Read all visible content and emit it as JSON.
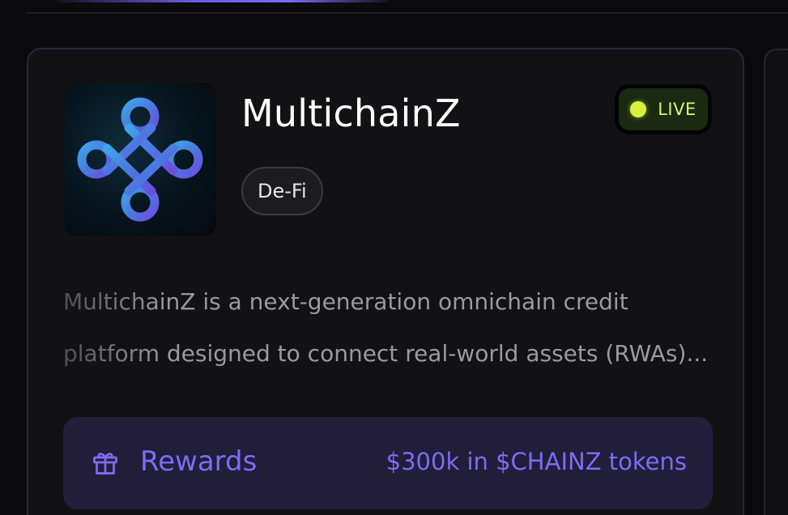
{
  "project": {
    "name": "MultichainZ",
    "category": "De-Fi",
    "status": "LIVE",
    "description_lines": [
      "MultichainZ is a next-generation omnichain credit",
      "platform designed to connect real-world assets (RWAs)..."
    ],
    "logo": "multichainz-knot-logo"
  },
  "rewards": {
    "icon": "gift-icon",
    "label": "Rewards",
    "value": "$300k in $CHAINZ tokens"
  },
  "colors": {
    "accent": "#7c6cf4",
    "live": "#d7f23c",
    "background": "#0b0b0d"
  }
}
